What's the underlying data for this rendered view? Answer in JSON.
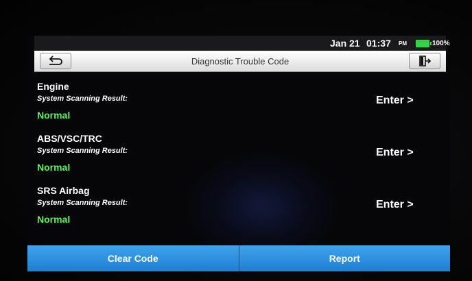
{
  "status_bar": {
    "date": "Jan 21",
    "time": "01:37",
    "ampm": "PM",
    "battery_percent": "100%",
    "battery_icon": "battery-full-icon",
    "battery_color": "#39d04a"
  },
  "title_bar": {
    "title": "Diagnostic Trouble Code",
    "back_icon": "back-arrow-icon",
    "exit_icon": "exit-icon"
  },
  "systems": [
    {
      "name": "Engine",
      "scan_label": "System Scanning Result:",
      "status": "Normal",
      "enter_label": "Enter >"
    },
    {
      "name": "ABS/VSC/TRC",
      "scan_label": "System Scanning Result:",
      "status": "Normal",
      "enter_label": "Enter >"
    },
    {
      "name": "SRS Airbag",
      "scan_label": "System Scanning Result:",
      "status": "Normal",
      "enter_label": "Enter >"
    }
  ],
  "bottom_bar": {
    "clear_code_label": "Clear Code",
    "report_label": "Report"
  },
  "colors": {
    "status_ok": "#5ef25e",
    "button_blue": "#2b8fe0"
  }
}
